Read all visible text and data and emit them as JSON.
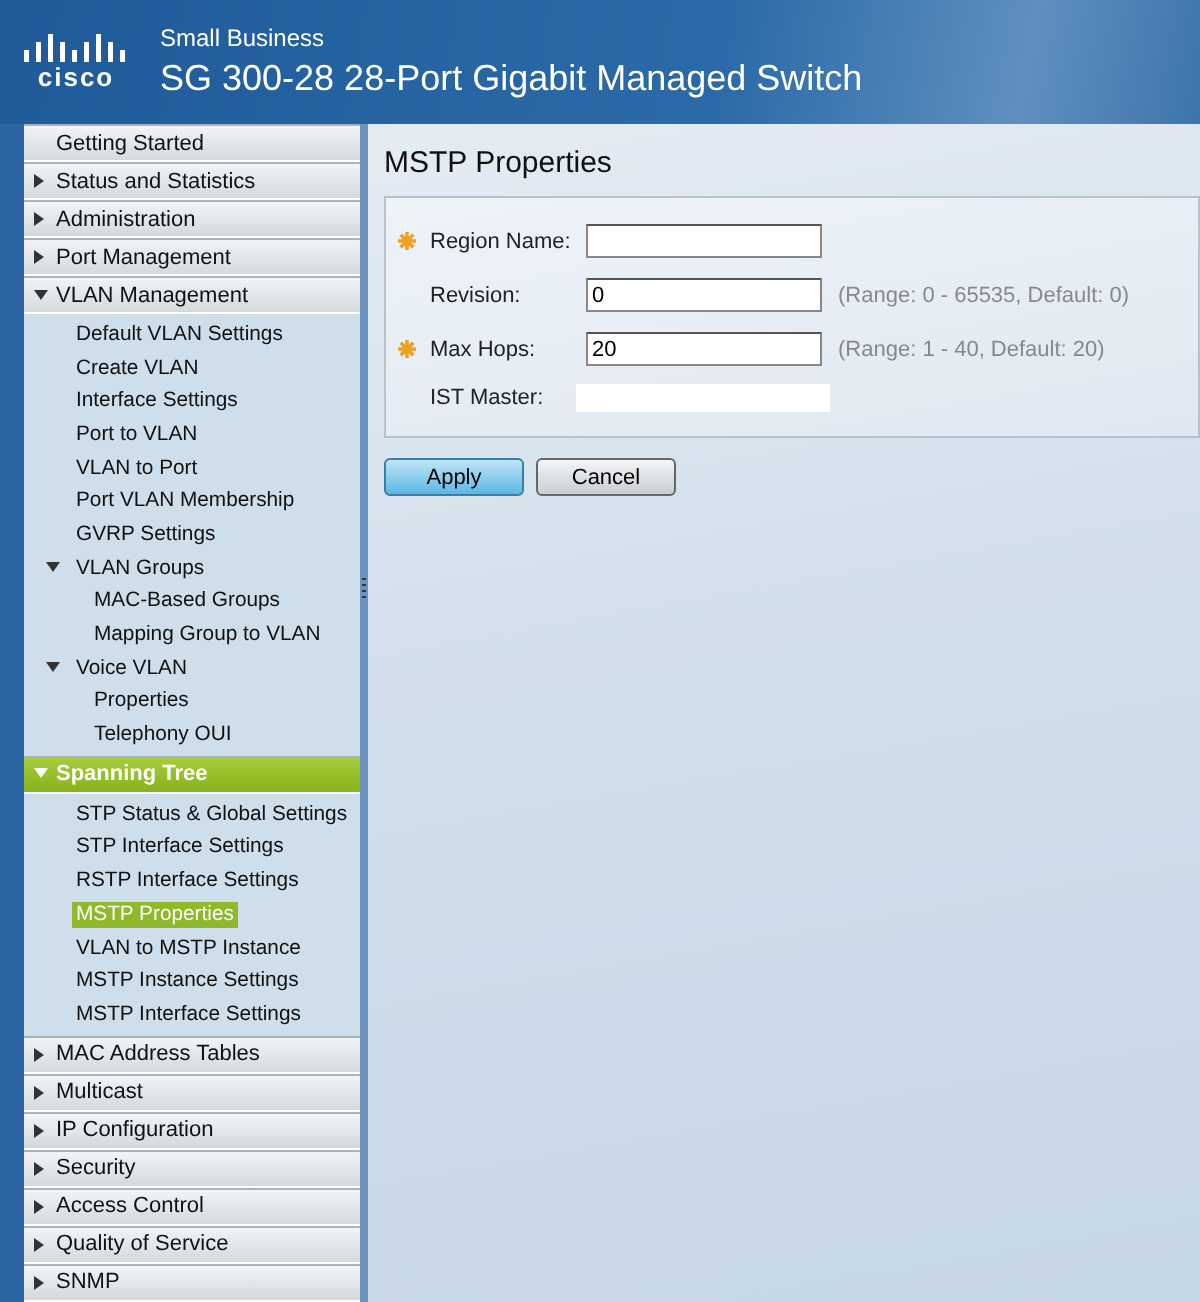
{
  "header": {
    "logo": "cisco",
    "brand": "Small Business",
    "title": "SG 300-28 28-Port Gigabit Managed Switch"
  },
  "sidebar": {
    "items": [
      {
        "label": "Getting Started",
        "kind": "link",
        "selected": false
      },
      {
        "label": "Status and Statistics",
        "kind": "folder",
        "expanded": false,
        "selected": false
      },
      {
        "label": "Administration",
        "kind": "folder",
        "expanded": false,
        "selected": false
      },
      {
        "label": "Port Management",
        "kind": "folder",
        "expanded": false,
        "selected": false
      },
      {
        "label": "VLAN Management",
        "kind": "folder",
        "expanded": true,
        "selected": false,
        "children": [
          {
            "label": "Default VLAN Settings",
            "selected": false
          },
          {
            "label": "Create VLAN",
            "selected": false
          },
          {
            "label": "Interface Settings",
            "selected": false
          },
          {
            "label": "Port to VLAN",
            "selected": false
          },
          {
            "label": "VLAN to Port",
            "selected": false
          },
          {
            "label": "Port VLAN Membership",
            "selected": false
          },
          {
            "label": "GVRP Settings",
            "selected": false
          },
          {
            "label": "VLAN Groups",
            "expanded": true,
            "selected": false,
            "children": [
              {
                "label": "MAC-Based Groups",
                "selected": false
              },
              {
                "label": "Mapping Group to VLAN",
                "selected": false
              }
            ]
          },
          {
            "label": "Voice VLAN",
            "expanded": true,
            "selected": false,
            "children": [
              {
                "label": "Properties",
                "selected": false
              },
              {
                "label": "Telephony OUI",
                "selected": false
              }
            ]
          }
        ]
      },
      {
        "label": "Spanning Tree",
        "kind": "folder",
        "expanded": true,
        "selected": true,
        "children": [
          {
            "label": "STP Status & Global Settings",
            "selected": false
          },
          {
            "label": "STP Interface Settings",
            "selected": false
          },
          {
            "label": "RSTP Interface Settings",
            "selected": false
          },
          {
            "label": "MSTP Properties",
            "selected": true
          },
          {
            "label": "VLAN to MSTP Instance",
            "selected": false
          },
          {
            "label": "MSTP Instance Settings",
            "selected": false
          },
          {
            "label": "MSTP Interface Settings",
            "selected": false
          }
        ]
      },
      {
        "label": "MAC Address Tables",
        "kind": "folder",
        "expanded": false,
        "selected": false
      },
      {
        "label": "Multicast",
        "kind": "folder",
        "expanded": false,
        "selected": false
      },
      {
        "label": "IP Configuration",
        "kind": "folder",
        "expanded": false,
        "selected": false
      },
      {
        "label": "Security",
        "kind": "folder",
        "expanded": false,
        "selected": false
      },
      {
        "label": "Access Control",
        "kind": "folder",
        "expanded": false,
        "selected": false
      },
      {
        "label": "Quality of Service",
        "kind": "folder",
        "expanded": false,
        "selected": false
      },
      {
        "label": "SNMP",
        "kind": "folder",
        "expanded": false,
        "selected": false
      }
    ]
  },
  "page": {
    "title": "MSTP Properties",
    "fields": [
      {
        "label": "Region Name:",
        "kind": "input",
        "required": true
      },
      {
        "label": "Revision:",
        "kind": "input",
        "required": false,
        "value": "0",
        "hint": "(Range: 0 - 65535, Default: 0)"
      },
      {
        "label": "Max Hops:",
        "kind": "input",
        "required": true,
        "value": "20",
        "hint": "(Range: 1 - 40, Default: 20)"
      },
      {
        "label": "IST Master:",
        "kind": "readonly",
        "required": false
      }
    ],
    "buttons": [
      {
        "label": "Apply",
        "kind": "primary"
      },
      {
        "label": "Cancel",
        "kind": "secondary"
      }
    ]
  }
}
